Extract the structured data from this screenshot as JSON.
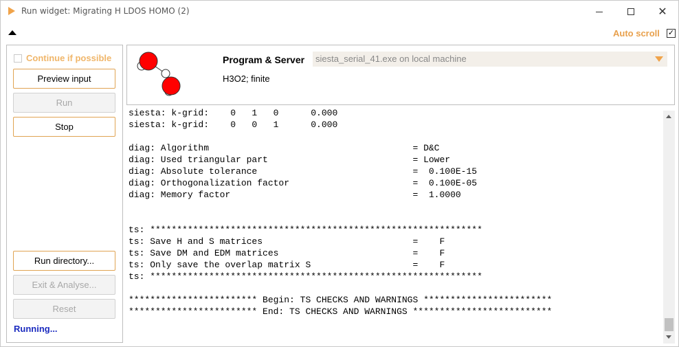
{
  "window": {
    "title": "Run widget: Migrating H LDOS HOMO (2)",
    "icon": "run-triangle-icon",
    "controls": [
      "minimize-icon",
      "maximize-icon",
      "close-icon"
    ],
    "close_glyph": "✕"
  },
  "toolbar": {
    "auto_scroll_label": "Auto scroll",
    "auto_scroll_checked": true,
    "check_glyph": "✓"
  },
  "left_panel": {
    "continue_label": "Continue if possible",
    "continue_checked": false,
    "buttons": {
      "preview": "Preview input",
      "run": "Run",
      "stop": "Stop",
      "run_directory": "Run directory...",
      "exit_analyse": "Exit & Analyse...",
      "reset": "Reset"
    },
    "status": "Running..."
  },
  "header": {
    "program_server_label": "Program & Server",
    "server_value": "siesta_serial_41.exe on local machine",
    "formula": "H3O2; finite"
  },
  "output": {
    "lines": [
      "siesta: k-grid:    0   1   0      0.000",
      "siesta: k-grid:    0   0   1      0.000",
      "",
      "diag: Algorithm                                      = D&C",
      "diag: Used triangular part                           = Lower",
      "diag: Absolute tolerance                             =  0.100E-15",
      "diag: Orthogonalization factor                       =  0.100E-05",
      "diag: Memory factor                                  =  1.0000",
      "",
      "",
      "ts: **************************************************************",
      "ts: Save H and S matrices                            =    F",
      "ts: Save DM and EDM matrices                         =    F",
      "ts: Only save the overlap matrix S                   =    F",
      "ts: **************************************************************",
      "",
      "************************ Begin: TS CHECKS AND WARNINGS ************************",
      "************************ End: TS CHECKS AND WARNINGS **************************"
    ]
  },
  "colors": {
    "accent": "#e8a04c",
    "running": "#1b2bbf",
    "oxygen": "#ff0000",
    "hydrogen": "#ffffff"
  }
}
